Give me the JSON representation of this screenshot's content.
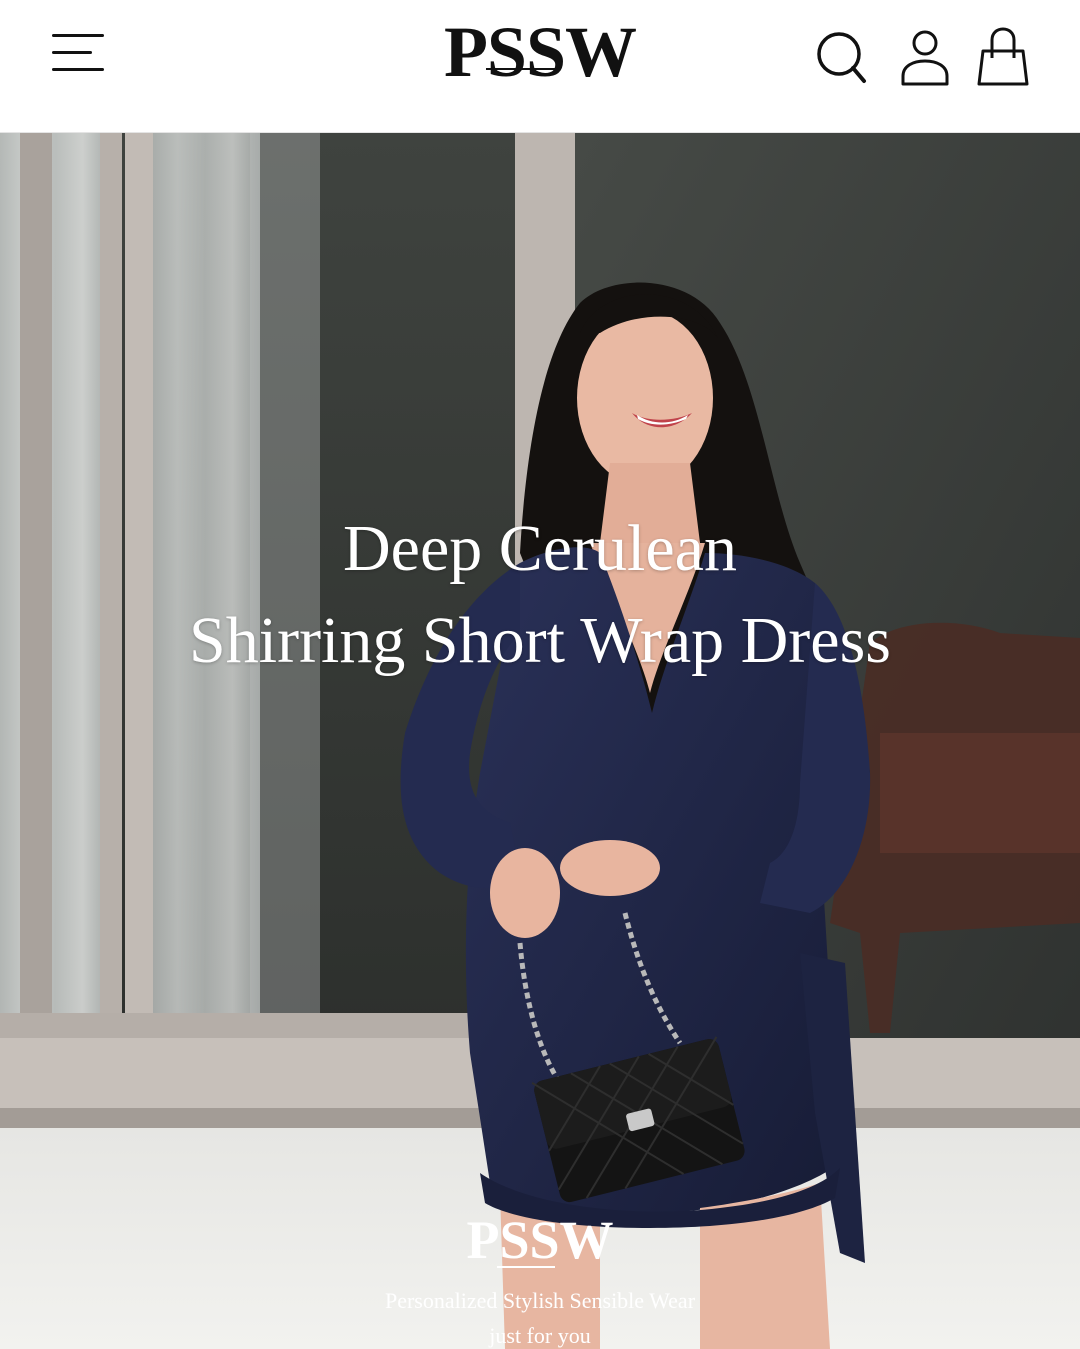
{
  "header": {
    "logo": "PSSW",
    "menu_icon": "hamburger-menu-icon",
    "search_icon": "search-icon",
    "account_icon": "user-icon",
    "bag_icon": "shopping-bag-icon"
  },
  "hero": {
    "title_line1": "Deep Cerulean",
    "title_line2": "Shirring Short Wrap Dress",
    "brand": "PSSW",
    "tagline_line1": "Personalized Stylish Sensible Wear",
    "tagline_line2": "just for you"
  },
  "colors": {
    "header_bg": "#ffffff",
    "text_dark": "#111111",
    "hero_text": "#ffffff",
    "dress_navy": "#1f2546"
  }
}
